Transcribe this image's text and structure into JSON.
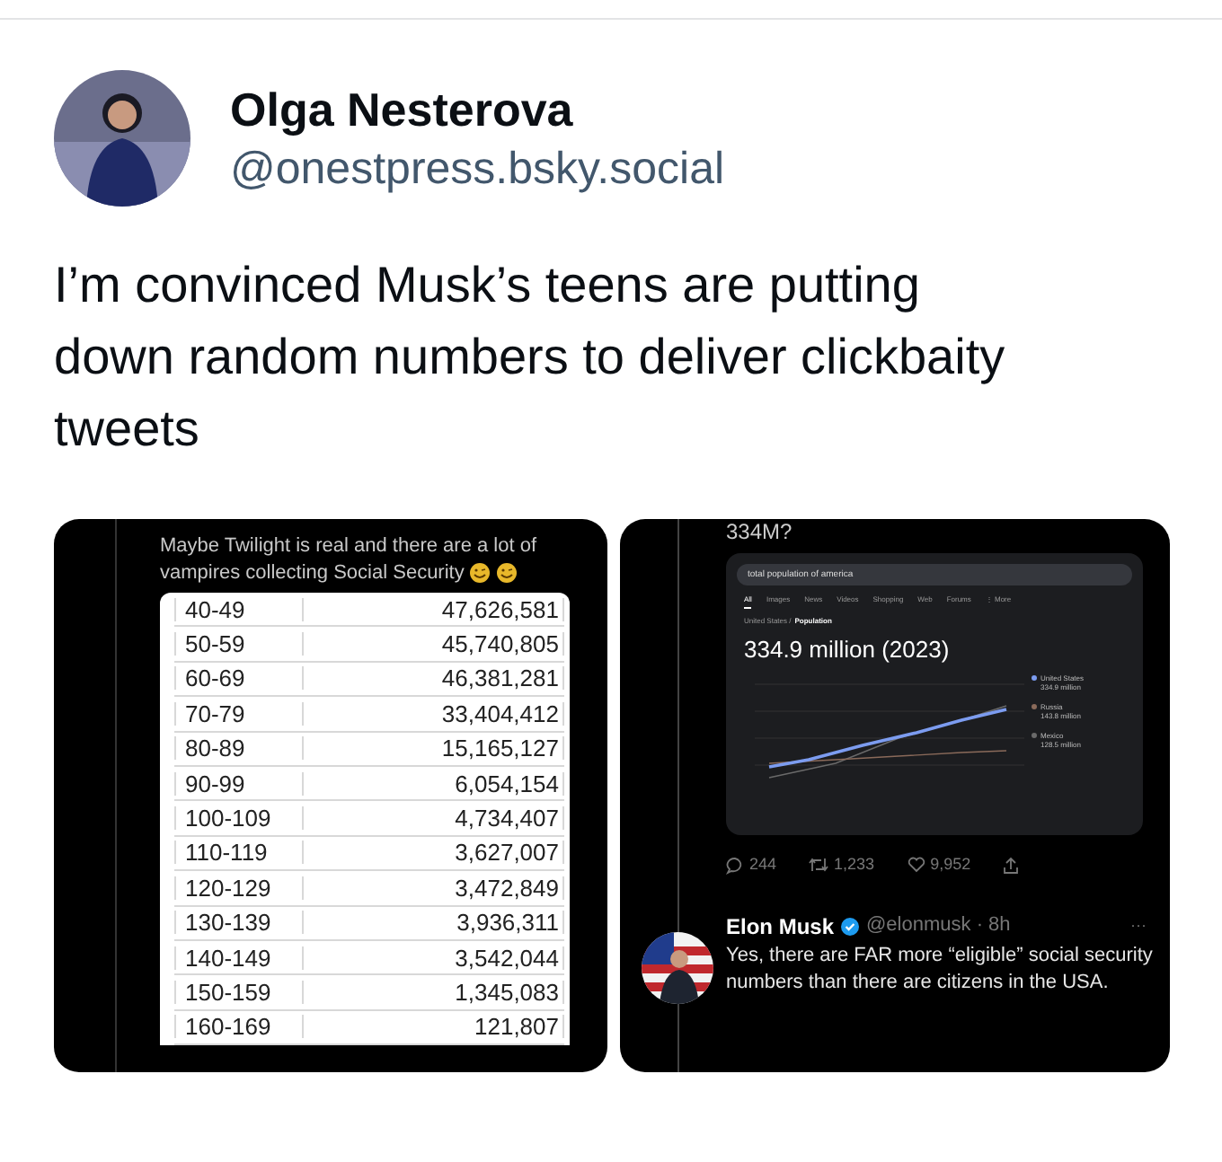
{
  "author": {
    "name": "Olga Nesterova",
    "handle": "@onestpress.bsky.social"
  },
  "post_text": "I’m convinced Musk’s teens are putting down random numbers to deliver clickbaity tweets",
  "left_image": {
    "caption": "Maybe Twilight is real and there are a lot of vampires collecting Social Security",
    "rows": [
      {
        "age": "40-49",
        "count": "47,626,581"
      },
      {
        "age": "50-59",
        "count": "45,740,805"
      },
      {
        "age": "60-69",
        "count": "46,381,281"
      },
      {
        "age": "70-79",
        "count": "33,404,412"
      },
      {
        "age": "80-89",
        "count": "15,165,127"
      },
      {
        "age": "90-99",
        "count": "6,054,154"
      },
      {
        "age": "100-109",
        "count": "4,734,407"
      },
      {
        "age": "110-119",
        "count": "3,627,007"
      },
      {
        "age": "120-129",
        "count": "3,472,849"
      },
      {
        "age": "130-139",
        "count": "3,936,311"
      },
      {
        "age": "140-149",
        "count": "3,542,044"
      },
      {
        "age": "150-159",
        "count": "1,345,083"
      },
      {
        "age": "160-169",
        "count": "121,807"
      }
    ]
  },
  "right_image": {
    "top_text": "334M?",
    "search": {
      "value": "total population of america"
    },
    "tabs": [
      {
        "label": "All",
        "selected": true
      },
      {
        "label": "Images",
        "selected": false
      },
      {
        "label": "News",
        "selected": false
      },
      {
        "label": "Videos",
        "selected": false
      },
      {
        "label": "Shopping",
        "selected": false
      },
      {
        "label": "Web",
        "selected": false
      },
      {
        "label": "Forums",
        "selected": false
      },
      {
        "label": "⋮ More",
        "selected": false
      }
    ],
    "breadcrumb_prefix": "United States /",
    "breadcrumb": "Population",
    "headline": "334.9 million (2023)",
    "legend": [
      {
        "name": "United States",
        "value": "334.9 million",
        "color": "#7c9cf0"
      },
      {
        "name": "Russia",
        "value": "143.8 million",
        "color": "#8a6a5a"
      },
      {
        "name": "Mexico",
        "value": "128.5 million",
        "color": "#6a6a6a"
      }
    ],
    "actions": {
      "replies": "244",
      "reposts": "1,233",
      "likes": "9,952"
    },
    "reply": {
      "name": "Elon Musk",
      "handle": "@elonmusk · 8h",
      "more": "···",
      "text": "Yes, there are FAR more “eligible” social security numbers than there are citizens in the USA."
    }
  }
}
